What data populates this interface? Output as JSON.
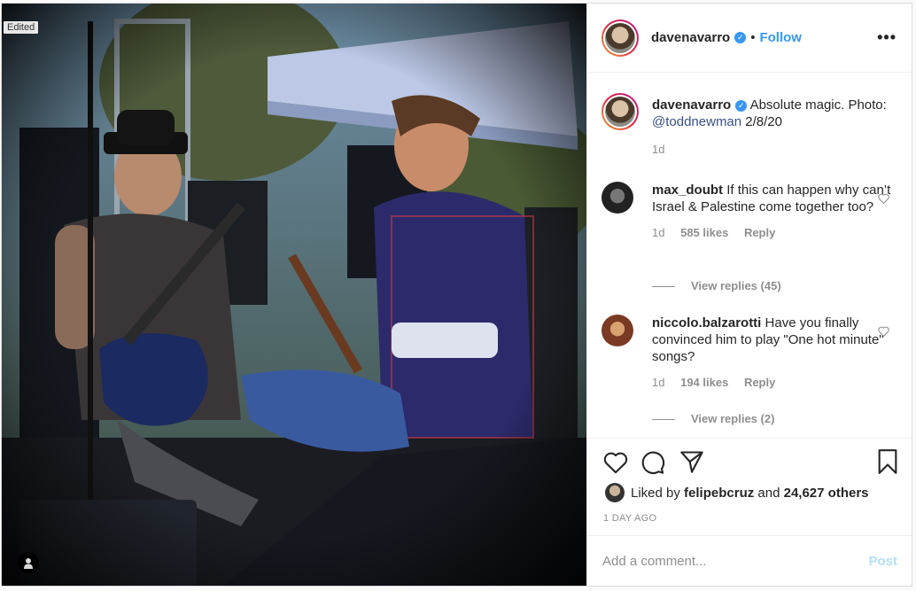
{
  "photo": {
    "edited_label": "Edited"
  },
  "header": {
    "username": "davenavarro",
    "verified": true,
    "separator": "•",
    "follow_label": "Follow",
    "more_label": "•••"
  },
  "caption": {
    "username": "davenavarro",
    "text_before": "Absolute magic. Photo: ",
    "mention": "@toddnewman",
    "text_after": " 2/8/20",
    "time": "1d"
  },
  "comments": [
    {
      "username": "max_doubt",
      "text": "If this can happen why can’t Israel & Palestine come together too?",
      "time": "1d",
      "likes": "585 likes",
      "reply_label": "Reply",
      "view_replies": "View replies (45)"
    },
    {
      "username": "niccolo.balzarotti",
      "text": "Have you finally convinced him to play \"One hot minute\" songs?",
      "time": "1d",
      "likes": "194 likes",
      "reply_label": "Reply",
      "view_replies": "View replies (2)"
    }
  ],
  "actions": {
    "liked_by_prefix": "Liked by",
    "liked_by_user": "felipebcruz",
    "liked_by_and": "and",
    "others_count": "24,627 others",
    "time_ago": "1 DAY AGO"
  },
  "add_comment": {
    "placeholder": "Add a comment...",
    "post_label": "Post"
  },
  "colors": {
    "accent": "#3897f0",
    "post_disabled": "#b2dffc",
    "muted": "#8e8e8e",
    "text": "#262626"
  },
  "icons": [
    "heart-icon",
    "comment-icon",
    "share-icon",
    "bookmark-icon",
    "user-tag-icon",
    "verified-icon",
    "more-icon"
  ]
}
